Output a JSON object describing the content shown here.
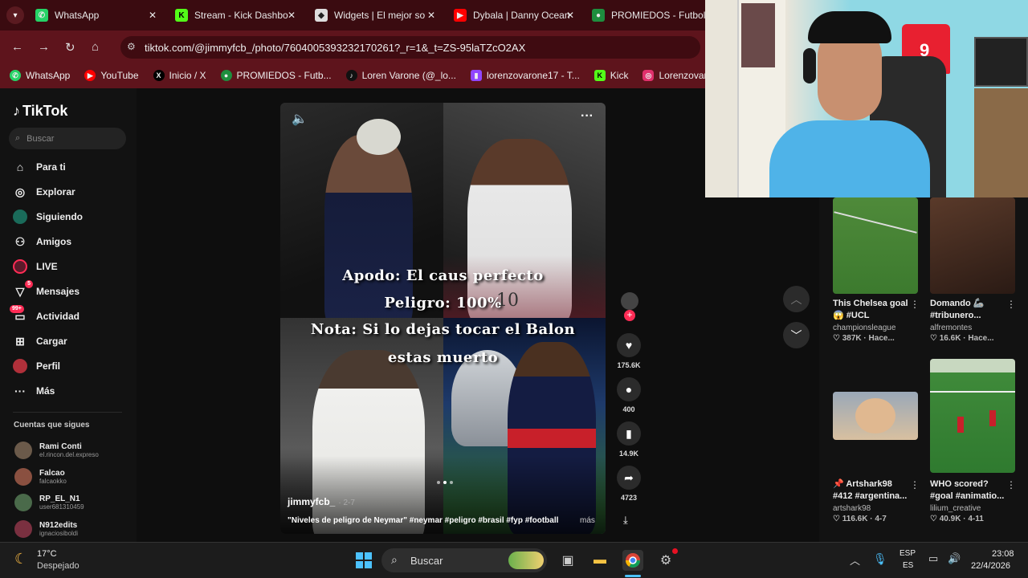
{
  "browser": {
    "tabs": [
      {
        "label": "WhatsApp",
        "favicon": "whatsapp-icon"
      },
      {
        "label": "Stream - Kick Dashbo",
        "favicon": "kick-icon"
      },
      {
        "label": "Widgets | El mejor so",
        "favicon": "widgets-icon"
      },
      {
        "label": "Dybala | Danny Ocean",
        "favicon": "youtube-icon"
      },
      {
        "label": "PROMIEDOS - Futbol",
        "favicon": "promiedos-icon"
      }
    ],
    "url": "tiktok.com/@jimmyfcb_/photo/7604005393232170261?_r=1&_t=ZS-95laTZcO2AX",
    "bookmarks": [
      {
        "label": "WhatsApp",
        "color": "#25d366"
      },
      {
        "label": "YouTube",
        "color": "#ff0000"
      },
      {
        "label": "Inicio / X",
        "color": "#000000"
      },
      {
        "label": "PROMIEDOS - Futb...",
        "color": "#1e8e3e"
      },
      {
        "label": "Loren Varone (@_lo...",
        "color": "#111111"
      },
      {
        "label": "lorenzovarone17 - T...",
        "color": "#9146ff"
      },
      {
        "label": "Kick",
        "color": "#53fc18"
      },
      {
        "label": "Lorenzovarone (Inst...",
        "color": "#e1306c"
      }
    ]
  },
  "tiktok": {
    "logo": "TikTok",
    "search_placeholder": "Buscar",
    "nav": [
      {
        "label": "Para ti",
        "icon": "home-icon"
      },
      {
        "label": "Explorar",
        "icon": "compass-icon"
      },
      {
        "label": "Siguiendo",
        "icon": "following-icon"
      },
      {
        "label": "Amigos",
        "icon": "friends-icon"
      },
      {
        "label": "LIVE",
        "icon": "live-icon"
      },
      {
        "label": "Mensajes",
        "icon": "messages-icon",
        "badge": "5"
      },
      {
        "label": "Actividad",
        "icon": "activity-icon",
        "badge": "99+"
      },
      {
        "label": "Cargar",
        "icon": "upload-icon"
      },
      {
        "label": "Perfil",
        "icon": "profile-icon"
      },
      {
        "label": "Más",
        "icon": "more-icon"
      }
    ],
    "following_header": "Cuentas que sigues",
    "following": [
      {
        "name": "Rami Conti",
        "handle": "el.rincon.del.expreso"
      },
      {
        "name": "Falcao",
        "handle": "falcaokko"
      },
      {
        "name": "RP_EL_N1",
        "handle": "user681310459"
      },
      {
        "name": "N912edits",
        "handle": "ignaciosiboldi"
      }
    ],
    "video": {
      "lines": [
        "Apodo: El caus perfecto",
        "Peligro: 100%",
        "Nota: Si lo dejas tocar el Balon",
        "estas muerto"
      ],
      "jersey_number": "10",
      "author": "jimmyfcb_",
      "date": "· 2-7",
      "caption": "\"Niveles de peligro de Neymar\" #neymar #peligro #brasil #fyp #football",
      "more": "más"
    },
    "actions": [
      {
        "icon": "heart-icon",
        "count": "175.6K"
      },
      {
        "icon": "comment-icon",
        "count": "400"
      },
      {
        "icon": "bookmark-icon",
        "count": "14.9K"
      },
      {
        "icon": "share-icon",
        "count": "4723"
      }
    ],
    "recommended": [
      {
        "title": "This Chelsea goal 😱 #UCL",
        "author": "championsleague",
        "meta": "♡ 387K · Hace..."
      },
      {
        "title": "Domando 🦾 #tribunero...",
        "author": "alfremontes",
        "meta": "♡ 16.6K · Hace..."
      },
      {
        "title": "📌 Artshark98 #412 #argentina...",
        "author": "artshark98",
        "meta": "♡ 116.6K · 4-7"
      },
      {
        "title": "WHO scored? #goal #animatio...",
        "author": "lilium_creative",
        "meta": "♡ 40.9K · 4-11"
      }
    ]
  },
  "taskbar": {
    "temp": "17°C",
    "weather": "Despejado",
    "search": "Buscar",
    "lang1": "ESP",
    "lang2": "ES",
    "time": "23:08",
    "date": "22/4/2026"
  }
}
